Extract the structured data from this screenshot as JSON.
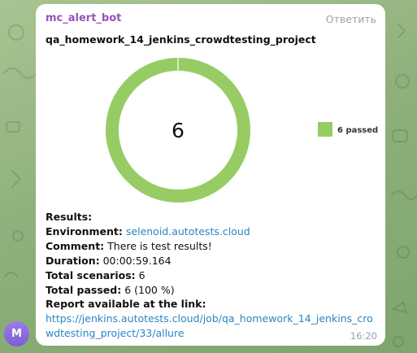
{
  "message": {
    "sender": "mc_alert_bot",
    "reply_label": "Ответить",
    "report_title": "qa_homework_14_jenkins_crowdtesting_project",
    "time": "16:20"
  },
  "avatar": {
    "letter": "M"
  },
  "chart_data": {
    "type": "pie",
    "center_label": "6",
    "categories": [
      "6 passed"
    ],
    "values": [
      6
    ],
    "series": [
      {
        "name": "6 passed",
        "values": [
          6
        ]
      }
    ],
    "colors": [
      "#97cc64"
    ],
    "legend_position": "right"
  },
  "info": {
    "results_label": "Results:",
    "environment_label": "Environment:",
    "environment_value": "selenoid.autotests.cloud",
    "comment_label": "Comment:",
    "comment_value": "There is test results!",
    "duration_label": "Duration:",
    "duration_value": "00:00:59.164",
    "total_scenarios_label": "Total scenarios:",
    "total_scenarios_value": "6",
    "total_passed_label": "Total passed:",
    "total_passed_value": "6 (100 %)",
    "report_label": "Report available at the link:",
    "report_url": "https://jenkins.autotests.cloud/job/qa_homework_14_jenkins_crowdtesting_project/33/allure"
  },
  "colors": {
    "sender": "#9553b4",
    "link": "#2a85c5",
    "muted": "#9aa3ab",
    "chart_green": "#97cc64",
    "avatar": "#8a6ddf"
  }
}
